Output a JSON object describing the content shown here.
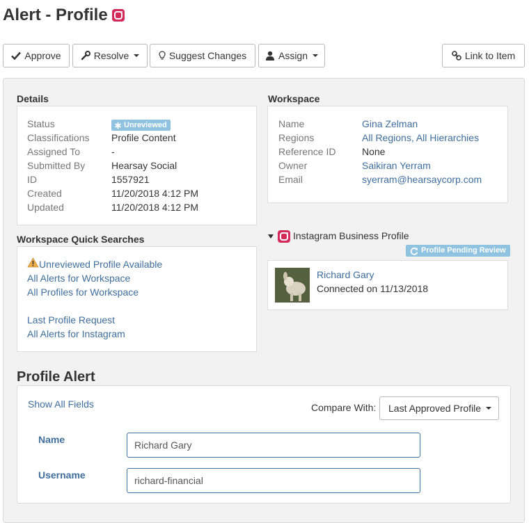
{
  "header": {
    "title": "Alert - Profile",
    "network_icon": "instagram-icon"
  },
  "toolbar": {
    "approve_label": "Approve",
    "resolve_label": "Resolve",
    "suggest_label": "Suggest Changes",
    "assign_label": "Assign",
    "link_label": "Link to Item"
  },
  "details": {
    "heading": "Details",
    "status_label": "Status",
    "status_value": "Unreviewed",
    "classifications_label": "Classifications",
    "classifications_value": "Profile Content",
    "assigned_label": "Assigned To",
    "assigned_value": "-",
    "submitted_label": "Submitted By",
    "submitted_value": "Hearsay Social",
    "id_label": "ID",
    "id_value": "1557921",
    "created_label": "Created",
    "created_value": "11/20/2018 4:12 PM",
    "updated_label": "Updated",
    "updated_value": "11/20/2018 4:12 PM"
  },
  "workspace": {
    "heading": "Workspace",
    "name_label": "Name",
    "name_value": "Gina Zelman",
    "regions_label": "Regions",
    "regions_value": "All Regions, All Hierarchies",
    "reference_label": "Reference ID",
    "reference_value": "None",
    "owner_label": "Owner",
    "owner_value": "Saikiran Yerram",
    "email_label": "Email",
    "email_value": "syerram@hearsaycorp.com"
  },
  "quick_searches": {
    "heading": "Workspace Quick Searches",
    "links": [
      "Unreviewed Profile Available",
      "All Alerts for Workspace",
      "All Profiles for Workspace",
      "Last Profile Request",
      "All Alerts for Instagram"
    ]
  },
  "business_profile": {
    "heading": "Instagram Business Profile",
    "badge": "Profile Pending Review",
    "name": "Richard Gary",
    "connected": "Connected on 11/13/2018"
  },
  "profile_alert": {
    "heading": "Profile Alert",
    "show_all": "Show All Fields",
    "compare_label": "Compare With:",
    "compare_value": "Last Approved Profile",
    "fields": [
      {
        "label": "Name",
        "value": "Richard Gary"
      },
      {
        "label": "Username",
        "value": "richard-financial"
      }
    ]
  },
  "colors": {
    "link": "#3f6e9d",
    "badge": "#8fc3df",
    "instagram": "#d42a5b",
    "warning": "#f0ad4e"
  }
}
